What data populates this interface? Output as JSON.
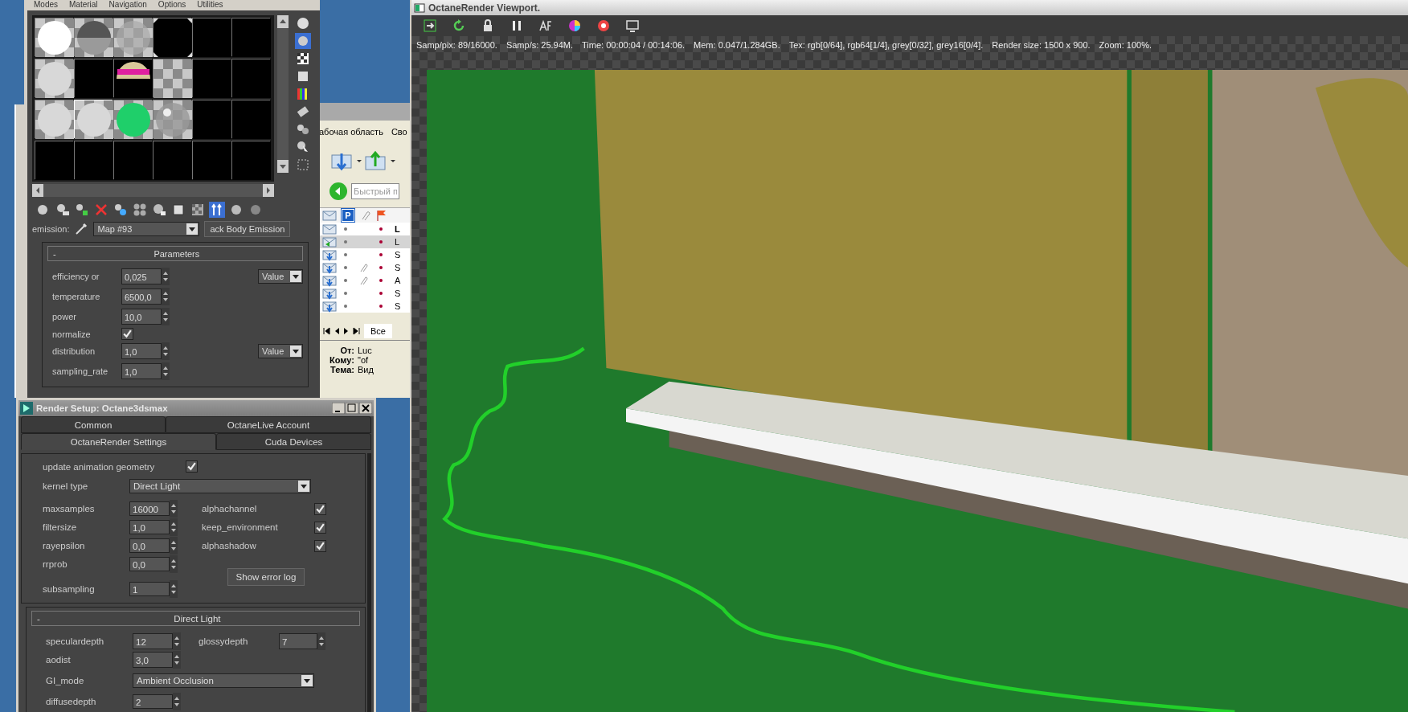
{
  "material_editor": {
    "menu": [
      "Modes",
      "Material",
      "Navigation",
      "Options",
      "Utilities"
    ],
    "slots": [
      {
        "kind": "white",
        "selected": false
      },
      {
        "kind": "mirror",
        "selected": false
      },
      {
        "kind": "checker-sphere",
        "selected": false
      },
      {
        "kind": "black",
        "selected": false
      },
      {
        "kind": "empty",
        "selected": false
      },
      {
        "kind": "empty",
        "selected": false
      },
      {
        "kind": "gray",
        "selected": false
      },
      {
        "kind": "empty",
        "selected": false
      },
      {
        "kind": "pink",
        "selected": false
      },
      {
        "kind": "checker",
        "selected": false
      },
      {
        "kind": "empty",
        "selected": false
      },
      {
        "kind": "empty",
        "selected": false
      },
      {
        "kind": "gray",
        "selected": false
      },
      {
        "kind": "gray",
        "selected": true
      },
      {
        "kind": "green",
        "selected": false
      },
      {
        "kind": "glass",
        "selected": false
      },
      {
        "kind": "empty",
        "selected": false
      },
      {
        "kind": "empty",
        "selected": false
      },
      {
        "kind": "empty",
        "selected": false
      },
      {
        "kind": "empty",
        "selected": false
      },
      {
        "kind": "empty",
        "selected": false
      },
      {
        "kind": "empty",
        "selected": false
      },
      {
        "kind": "empty",
        "selected": false
      },
      {
        "kind": "empty",
        "selected": false
      }
    ],
    "emission": {
      "label": "emission:",
      "map": "Map #93",
      "button": "ack Body Emission"
    },
    "parameters": {
      "collapse": "-",
      "title": "Parameters",
      "rows": [
        {
          "kind": "spinner",
          "label": "efficiency or",
          "value": "0,025",
          "dropdown": "Value"
        },
        {
          "kind": "spinner",
          "label": "temperature",
          "value": "6500,0"
        },
        {
          "kind": "spinner",
          "label": "power",
          "value": "10,0"
        },
        {
          "kind": "checkbox",
          "label": "normalize",
          "checked": true
        },
        {
          "kind": "spinner",
          "label": "distribution",
          "value": "1,0",
          "dropdown": "Value"
        },
        {
          "kind": "spinner",
          "label": "sampling_rate",
          "value": "1,0"
        }
      ]
    }
  },
  "mail_client": {
    "menu": [
      "абочая область",
      "Сво"
    ],
    "search": {
      "placeholder": "Быстрый п"
    },
    "columns": [
      {
        "kind": "envelope"
      },
      {
        "kind": "priority",
        "label": "P"
      },
      {
        "kind": "attachment"
      },
      {
        "kind": "flag"
      }
    ],
    "rows": [
      {
        "kind": "new",
        "subject": "L",
        "attachment": false,
        "selected": false
      },
      {
        "kind": "replied",
        "subject": "L",
        "attachment": false,
        "selected": true
      },
      {
        "kind": "received",
        "subject": "S",
        "attachment": false,
        "selected": false
      },
      {
        "kind": "received",
        "subject": "S",
        "attachment": true,
        "selected": false
      },
      {
        "kind": "received",
        "subject": "A",
        "attachment": true,
        "selected": false
      },
      {
        "kind": "received",
        "subject": "S",
        "attachment": false,
        "selected": false
      },
      {
        "kind": "received",
        "subject": "S",
        "attachment": false,
        "selected": false
      }
    ],
    "folder_tab": "Все",
    "header": [
      {
        "label": "От:",
        "value": "Luc"
      },
      {
        "label": "Кому:",
        "value": "\"of"
      },
      {
        "label": "Тема:",
        "value": "Вид"
      }
    ]
  },
  "render_setup": {
    "title": "Render Setup: Octane3dsmax",
    "tab_rows": [
      {
        "tabs": [
          {
            "label": "Common",
            "selected": false
          },
          {
            "label": "OctaneLive Account",
            "selected": false
          }
        ]
      },
      {
        "tabs": [
          {
            "label": "OctaneRender Settings",
            "selected": true
          },
          {
            "label": "Cuda Devices",
            "selected": false
          }
        ]
      }
    ],
    "update_geometry": {
      "label": "update animation geometry",
      "checked": true
    },
    "kernel_type": {
      "label": "kernel type",
      "value": "Direct Light"
    },
    "fields": [
      {
        "label": "maxsamples",
        "value": "16000"
      },
      {
        "label": "filtersize",
        "value": "1,0"
      },
      {
        "label": "rayepsilon",
        "value": "0,0"
      },
      {
        "label": "rrprob",
        "value": "0,0"
      }
    ],
    "checks": [
      {
        "label": "alphachannel",
        "checked": true
      },
      {
        "label": "keep_environment",
        "checked": true
      },
      {
        "label": "alphashadow",
        "checked": true
      }
    ],
    "error_log_button": "Show error log",
    "subsampling": {
      "label": "subsampling",
      "value": "1"
    },
    "direct_light": {
      "collapse": "-",
      "title": "Direct Light",
      "speculardepth": {
        "label": "speculardepth",
        "value": "12"
      },
      "glossydepth": {
        "label": "glossydepth",
        "value": "7"
      },
      "aodist": {
        "label": "aodist",
        "value": "3,0"
      },
      "gi_mode": {
        "label": "GI_mode",
        "value": "Ambient Occlusion"
      },
      "diffusedepth": {
        "label": "diffusedepth",
        "value": "2"
      }
    }
  },
  "viewport": {
    "title": "OctaneRender Viewport.",
    "status": [
      "Samp/pix: 89/16000.",
      "Samp/s: 25.94M.",
      "Time: 00:00:04 / 00:14:06.",
      "Mem: 0.047/1.284GB.",
      "Tex: rgb[0/64], rgb64[1/4], grey[0/32], grey16[0/4].",
      "Render size: 1500 x 900.",
      "Zoom: 100%."
    ]
  }
}
